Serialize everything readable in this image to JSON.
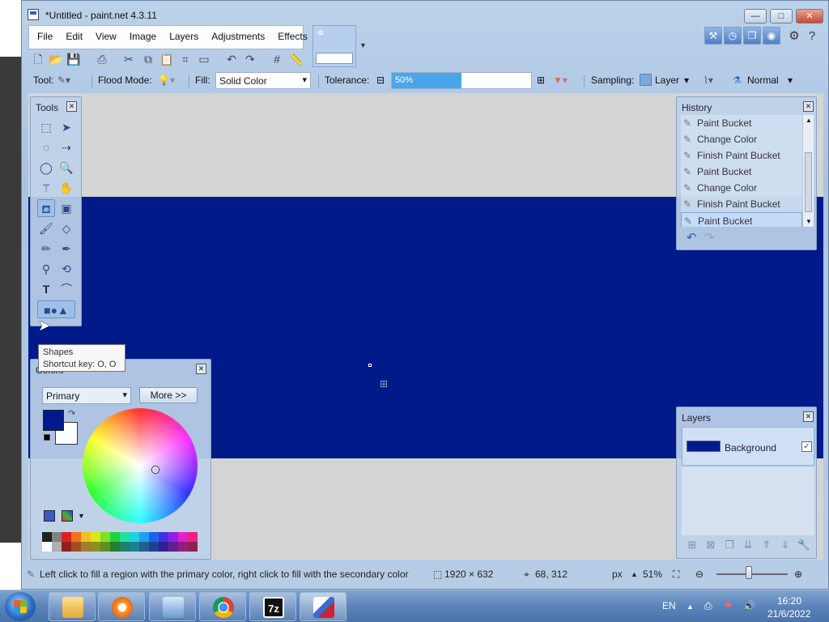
{
  "window": {
    "title": "*Untitled - paint.net 4.3.11",
    "min_label": "—",
    "max_label": "□",
    "close_label": "✕"
  },
  "menu": [
    "File",
    "Edit",
    "View",
    "Image",
    "Layers",
    "Adjustments",
    "Effects"
  ],
  "options_bar": {
    "tool_label": "Tool:",
    "flood_mode_label": "Flood Mode:",
    "fill_label": "Fill:",
    "fill_value": "Solid Color",
    "tolerance_label": "Tolerance:",
    "tolerance_value": "50%",
    "tolerance_fraction": 0.5,
    "sampling_label": "Sampling:",
    "sampling_value": "Layer",
    "blend_mode_value": "Normal"
  },
  "tools_panel": {
    "title": "Tools",
    "tooltip_title": "Shapes",
    "tooltip_shortcut": "Shortcut key: O, O"
  },
  "colors_panel": {
    "title": "Colors",
    "selector_value": "Primary",
    "more_label": "More >>",
    "primary_color": "#001a8a",
    "secondary_color": "#ffffff",
    "palette_row1": [
      "#202020",
      "#808080",
      "#e02020",
      "#f07020",
      "#f0c020",
      "#d8e820",
      "#80e020",
      "#20d040",
      "#20e0a0",
      "#20d0e0",
      "#20a0f0",
      "#2060f0",
      "#4030e0",
      "#9020e0",
      "#e020d0",
      "#f02080"
    ],
    "palette_row2": [
      "#ffffff",
      "#b0b0b0",
      "#902020",
      "#a05020",
      "#a08030",
      "#909020",
      "#609020",
      "#208030",
      "#208070",
      "#208090",
      "#206090",
      "#204090",
      "#302090",
      "#602090",
      "#902080",
      "#902050"
    ]
  },
  "history_panel": {
    "title": "History",
    "items": [
      "Paint Bucket",
      "Change Color",
      "Finish Paint Bucket",
      "Paint Bucket",
      "Change Color",
      "Finish Paint Bucket",
      "Paint Bucket"
    ],
    "active_index": 6
  },
  "layers_panel": {
    "title": "Layers",
    "layer_name": "Background",
    "layer_visible": "✓"
  },
  "canvas": {
    "image_color": "#001a8a",
    "background_color": "#d4d4d4"
  },
  "statusbar": {
    "hint": "Left click to fill a region with the primary color, right click to fill with the secondary color",
    "image_size": "1920 × 632",
    "cursor_pos": "68, 312",
    "units": "px",
    "zoom": "51%"
  },
  "taskbar": {
    "lang": "EN",
    "time": "16:20",
    "date": "21/6/2022",
    "sevenzip_label": "7z"
  }
}
